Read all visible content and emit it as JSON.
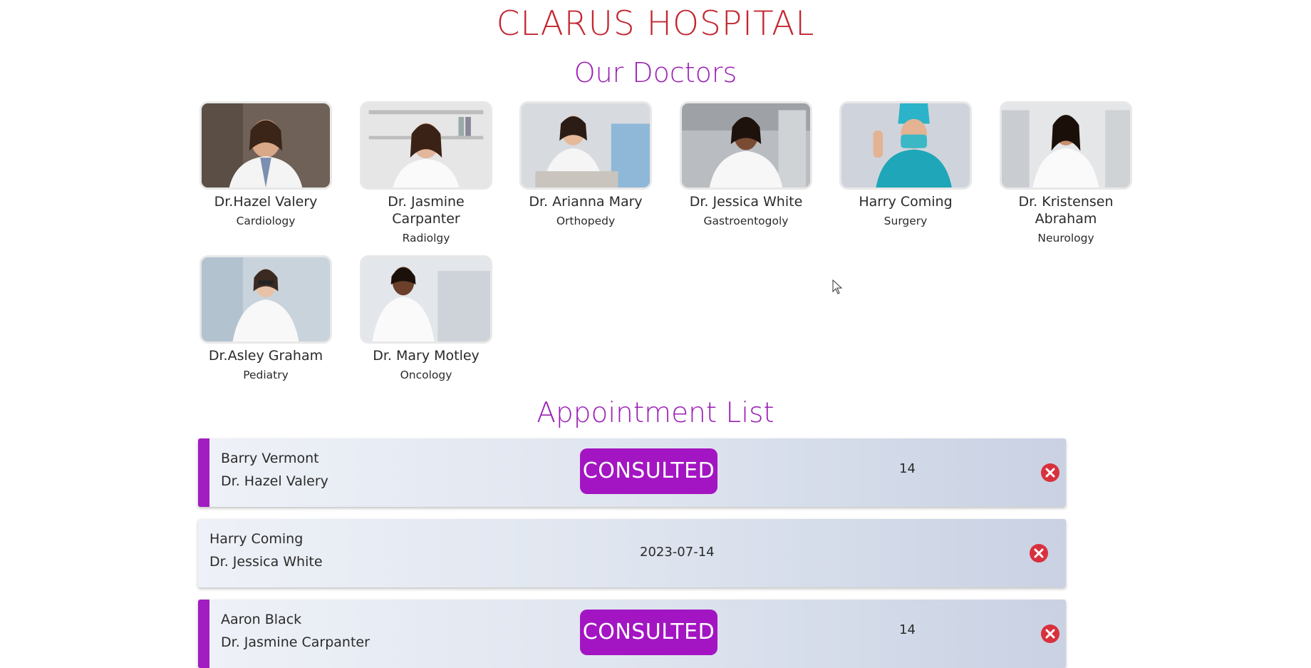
{
  "header": {
    "hospital_name": "CLARUS HOSPITAL",
    "doctors_heading": "Our Doctors"
  },
  "colors": {
    "title_red": "#c3262f",
    "heading_purple": "#9a1fb4",
    "badge_purple": "#a315c2",
    "delete_red": "#d8313d"
  },
  "doctors": [
    {
      "name": "Dr.Hazel Valery",
      "specialty": "Cardiology"
    },
    {
      "name": "Dr. Jasmine Carpanter",
      "specialty": "Radiolgy"
    },
    {
      "name": "Dr. Arianna Mary",
      "specialty": "Orthopedy"
    },
    {
      "name": "Dr. Jessica White",
      "specialty": "Gastroentogoly"
    },
    {
      "name": "Harry Coming",
      "specialty": "Surgery"
    },
    {
      "name": "Dr. Kristensen Abraham",
      "specialty": "Neurology"
    },
    {
      "name": "Dr.Asley Graham",
      "specialty": "Pediatry"
    },
    {
      "name": "Dr. Mary Motley",
      "specialty": "Oncology"
    }
  ],
  "appointments_heading": "Appointment List",
  "appointments": [
    {
      "patient": "Barry Vermont",
      "doctor": "Dr. Hazel Valery",
      "date_visible": "14",
      "status": "CONSULTED",
      "delete_icon": "x-circle-icon"
    },
    {
      "patient": "Harry Coming",
      "doctor": "Dr. Jessica White",
      "date_visible": "2023-07-14",
      "status": "",
      "delete_icon": "x-circle-icon"
    },
    {
      "patient": "Aaron Black",
      "doctor": "Dr. Jasmine Carpanter",
      "date_visible": "14",
      "status": "CONSULTED",
      "delete_icon": "x-circle-icon"
    }
  ]
}
